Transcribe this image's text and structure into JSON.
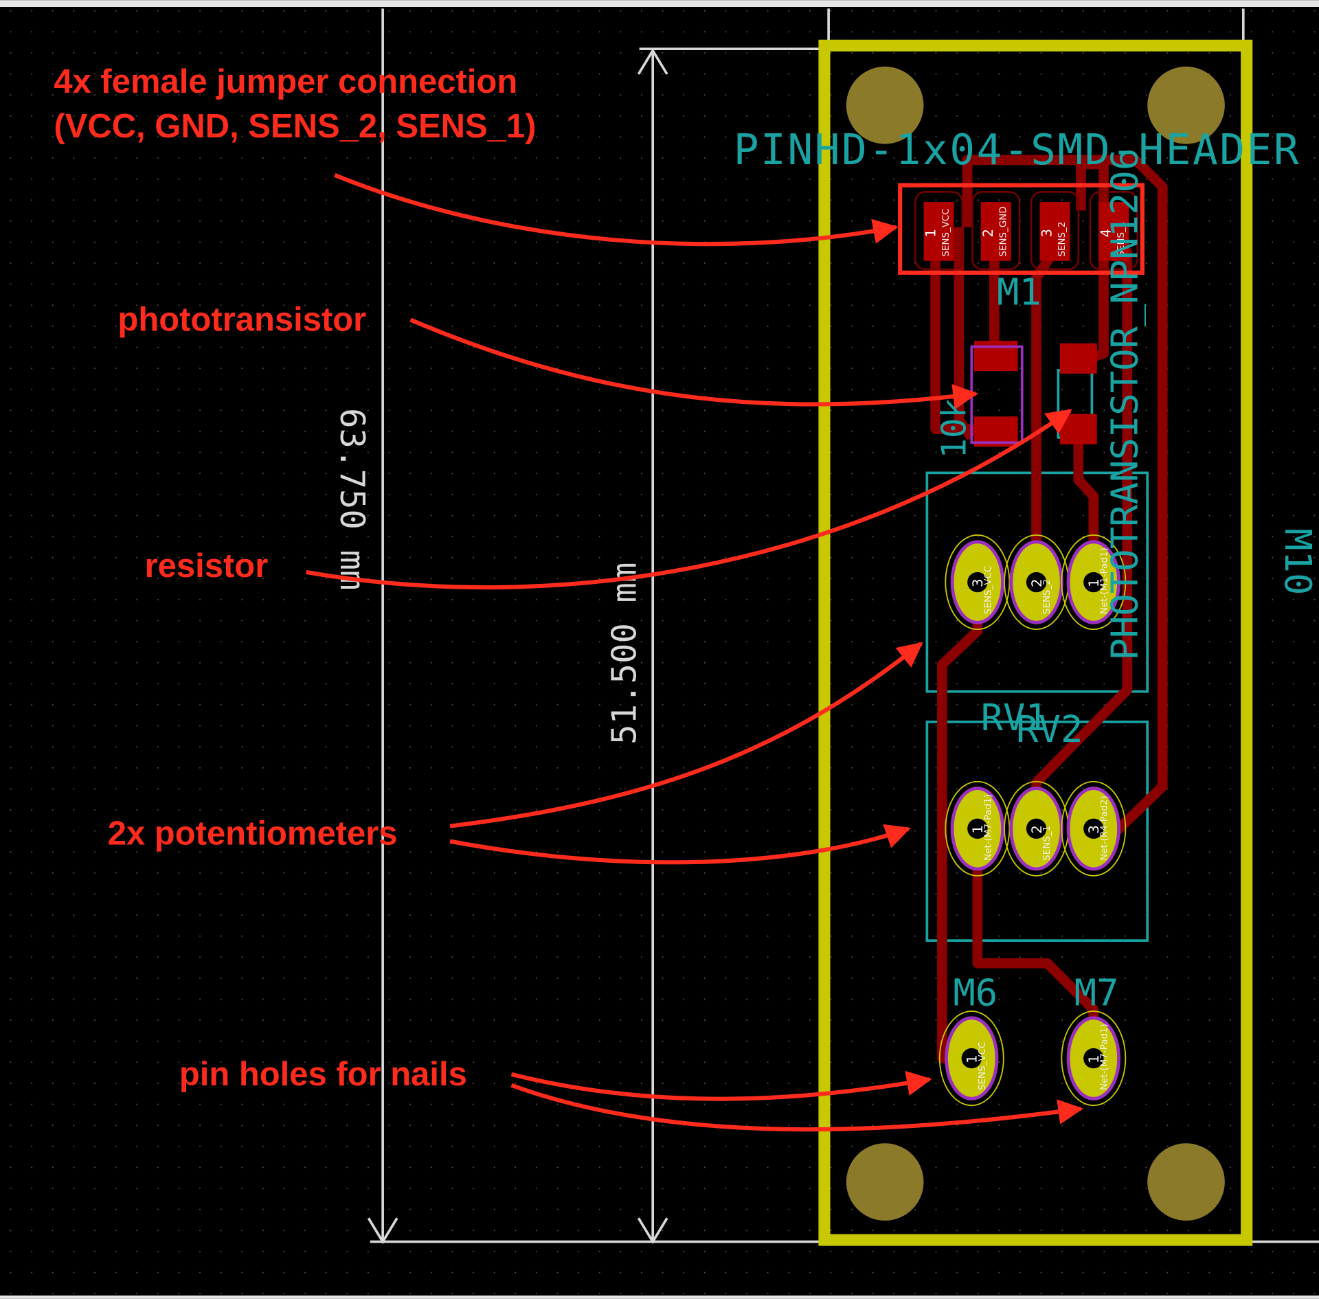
{
  "annotations": {
    "header_line1": "4x female jumper connection",
    "header_line2": "(VCC, GND, SENS_2, SENS_1)",
    "phototransistor": "phototransistor",
    "resistor": "resistor",
    "potentiometers": "2x potentiometers",
    "pin_holes": "pin holes for nails"
  },
  "dimensions": {
    "outer_height": "63.750 mm",
    "inner_height": "51.500 mm"
  },
  "silkscreen": {
    "header_footprint": "PINHD-1x04-SMD-HEADER",
    "phototransistor_footprint": "PHOTOTRANSISTOR_NPN1206",
    "m1": "M1",
    "m6": "M6",
    "m7": "M7",
    "m10": "M10",
    "rv1": "RV1",
    "rv2": "RV2",
    "resistor_value": "10k"
  },
  "header_pads": [
    {
      "num": "1",
      "net": "SENS_VCC"
    },
    {
      "num": "2",
      "net": "SENS_GND"
    },
    {
      "num": "3",
      "net": "SENS_2"
    },
    {
      "num": "4",
      "net": "SENS_1"
    }
  ],
  "rv1_pads": [
    {
      "num": "3",
      "net": "SENS_VCC"
    },
    {
      "num": "2",
      "net": "SENS_2"
    },
    {
      "num": "1",
      "net": "Net-(M1-Pad1)"
    }
  ],
  "rv2_pads": [
    {
      "num": "1",
      "net": "Net-(M7-Pad1)"
    },
    {
      "num": "2",
      "net": "SENS_1"
    },
    {
      "num": "3",
      "net": "Net-(R4-Pad2)"
    }
  ],
  "pin_pads": [
    {
      "num": "1",
      "net": "SENS_VCC"
    },
    {
      "num": "1",
      "net": "Net-(M7-Pad1)"
    }
  ],
  "colors": {
    "annotation": "#ff2b1c",
    "board_edge": "#c8c800",
    "copper_trace": "#8b0000",
    "pad": "#c8c800",
    "mount_hole": "#8b7a2a",
    "silkscreen": "#1aa3a3"
  }
}
